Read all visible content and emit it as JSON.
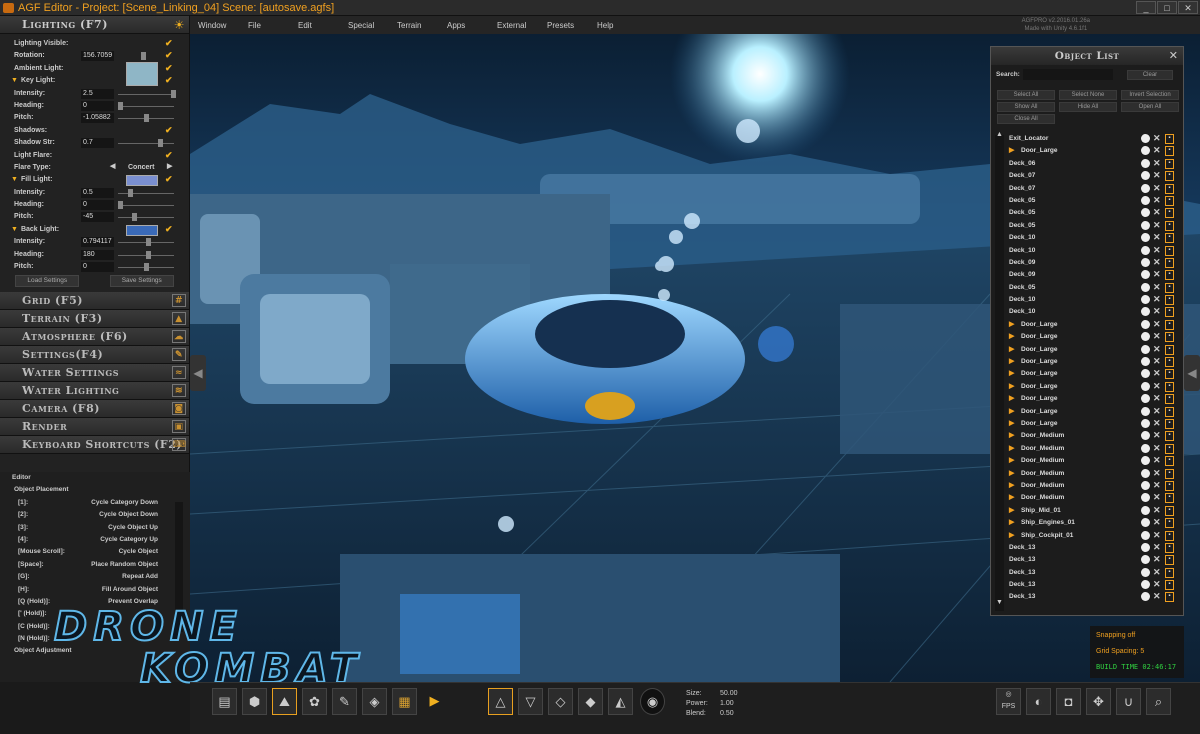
{
  "title": "AGF Editor - Project: [Scene_Linking_04] Scene: [autosave.agfs]",
  "menu": [
    "Window",
    "File",
    "Edit",
    "Special",
    "Terrain",
    "Apps",
    "External",
    "Presets",
    "Help"
  ],
  "version": [
    "AGFPRO v2.2016.01.26a",
    "Made with Unity 4.6.1f1"
  ],
  "lighting": {
    "header": "Lighting (F7)",
    "lighting_visible": "Lighting Visible:",
    "rotation_label": "Rotation:",
    "rotation_value": "156.7059",
    "ambient_label": "Ambient Light:",
    "key_light": "Key Light:",
    "intensity_label": "Intensity:",
    "heading_label": "Heading:",
    "pitch_label": "Pitch:",
    "key_intensity": "2.5",
    "key_heading": "0",
    "key_pitch": "-1.05882",
    "shadows_label": "Shadows:",
    "shadow_str_label": "Shadow Str:",
    "shadow_str": "0.7",
    "light_flare_label": "Light Flare:",
    "flare_type_label": "Flare Type:",
    "flare_type": "Concert",
    "fill_light": "Fill Light:",
    "fill_intensity": "0.5",
    "fill_heading": "0",
    "fill_pitch": "-45",
    "back_light": "Back Light:",
    "back_intensity": "0.794117",
    "back_heading": "180",
    "back_pitch": "0",
    "load_settings": "Load Settings",
    "save_settings": "Save Settings"
  },
  "sections": [
    "Grid (F5)",
    "Terrain (F3)",
    "Atmosphere (F6)",
    "Settings(F4)",
    "Water Settings",
    "Water Lighting",
    "Camera (F8)",
    "Render",
    "Keyboard Shortcuts (F2)"
  ],
  "editor": {
    "title": "Editor",
    "object_placement": "Object Placement",
    "shortcuts": [
      {
        "key": "[1]:",
        "desc": "Cycle Category Down"
      },
      {
        "key": "[2]:",
        "desc": "Cycle Object Down"
      },
      {
        "key": "[3]:",
        "desc": "Cycle Object Up"
      },
      {
        "key": "[4]:",
        "desc": "Cycle Category Up"
      },
      {
        "key": "[Mouse Scroll]:",
        "desc": "Cycle Object"
      },
      {
        "key": "[Space]:",
        "desc": "Place Random Object"
      },
      {
        "key": "[G]:",
        "desc": "Repeat Add"
      },
      {
        "key": "[H]:",
        "desc": "Fill Around Object"
      },
      {
        "key": "[Q (Hold)]:",
        "desc": "Prevent Overlap"
      },
      {
        "key": "[' (Hold)]:",
        "desc": ""
      },
      {
        "key": "[C (Hold)]:",
        "desc": ""
      },
      {
        "key": "[N (Hold)]:",
        "desc": ""
      }
    ],
    "object_adjustment": "Object Adjustment"
  },
  "logo_text": [
    "DRONE",
    "KOMBAT"
  ],
  "object_list": {
    "header": "Object List",
    "search_label": "Search:",
    "clear": "Clear",
    "buttons": [
      "Select All",
      "Select None",
      "Invert Selection",
      "Show All",
      "Hide All",
      "Open All",
      "Close All"
    ],
    "items": [
      {
        "name": "Exit_Locator",
        "folder": false
      },
      {
        "name": "Door_Large",
        "folder": true
      },
      {
        "name": "Deck_06",
        "folder": false
      },
      {
        "name": "Deck_07",
        "folder": false
      },
      {
        "name": "Deck_07",
        "folder": false
      },
      {
        "name": "Deck_05",
        "folder": false
      },
      {
        "name": "Deck_05",
        "folder": false
      },
      {
        "name": "Deck_05",
        "folder": false
      },
      {
        "name": "Deck_10",
        "folder": false
      },
      {
        "name": "Deck_10",
        "folder": false
      },
      {
        "name": "Deck_09",
        "folder": false
      },
      {
        "name": "Deck_09",
        "folder": false
      },
      {
        "name": "Deck_05",
        "folder": false
      },
      {
        "name": "Deck_10",
        "folder": false
      },
      {
        "name": "Deck_10",
        "folder": false
      },
      {
        "name": "Door_Large",
        "folder": true
      },
      {
        "name": "Door_Large",
        "folder": true
      },
      {
        "name": "Door_Large",
        "folder": true
      },
      {
        "name": "Door_Large",
        "folder": true
      },
      {
        "name": "Door_Large",
        "folder": true
      },
      {
        "name": "Door_Large",
        "folder": true
      },
      {
        "name": "Door_Large",
        "folder": true
      },
      {
        "name": "Door_Large",
        "folder": true
      },
      {
        "name": "Door_Large",
        "folder": true
      },
      {
        "name": "Door_Medium",
        "folder": true
      },
      {
        "name": "Door_Medium",
        "folder": true
      },
      {
        "name": "Door_Medium",
        "folder": true
      },
      {
        "name": "Door_Medium",
        "folder": true
      },
      {
        "name": "Door_Medium",
        "folder": true
      },
      {
        "name": "Door_Medium",
        "folder": true
      },
      {
        "name": "Ship_Mid_01",
        "folder": true
      },
      {
        "name": "Ship_Engines_01",
        "folder": true
      },
      {
        "name": "Ship_Cockpit_01",
        "folder": true
      },
      {
        "name": "Deck_13",
        "folder": false
      },
      {
        "name": "Deck_13",
        "folder": false
      },
      {
        "name": "Deck_13",
        "folder": false
      },
      {
        "name": "Deck_13",
        "folder": false
      },
      {
        "name": "Deck_13",
        "folder": false
      }
    ]
  },
  "status": {
    "snapping": "Snapping off",
    "grid_spacing": "Grid Spacing: 5",
    "build_time": "BUILD TIME 02:46:17"
  },
  "brush": {
    "size_label": "Size:",
    "size": "50.00",
    "power_label": "Power:",
    "power": "1.00",
    "blend_label": "Blend:",
    "blend": "0.50"
  },
  "fps_label": "FPS",
  "colors": {
    "accent": "#f0a020",
    "ambient": "#8fb6c6",
    "fill": "#7a8fd0",
    "back": "#3a6ab8",
    "build_time": "#30d040",
    "snapping": "#f0a020"
  }
}
